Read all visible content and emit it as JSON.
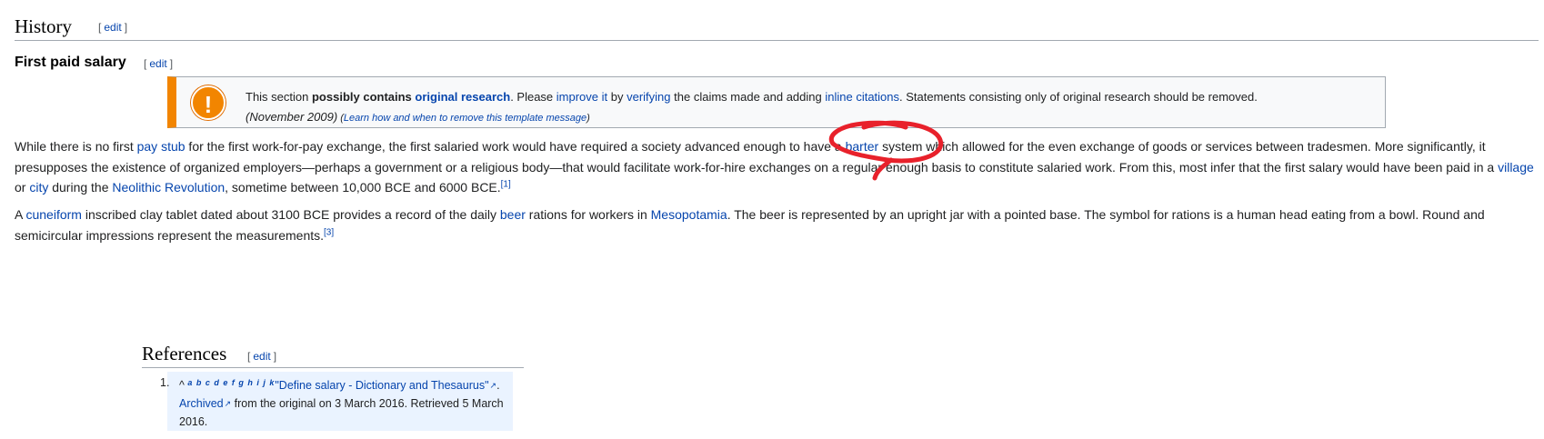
{
  "history": {
    "title": "History",
    "edit": "edit"
  },
  "first_paid_salary": {
    "title": "First paid salary",
    "edit": "edit"
  },
  "ambox": {
    "icon": "exclamation-icon",
    "l1_a": "This section ",
    "l1_b": "possibly contains ",
    "l1_c": "original research",
    "l1_d": ". Please ",
    "l1_e": "improve it",
    "l1_f": " by ",
    "l1_g": "verifying",
    "l1_h": " the claims made and adding ",
    "l1_i": "inline citations",
    "l1_j": ". Statements consisting only of original research should be removed.",
    "date": "(November 2009)",
    "learn_open": " (",
    "learn": "Learn how and when to remove this template message",
    "learn_close": ")"
  },
  "para1": {
    "l1_a": "While there is no first ",
    "l1_b": "pay stub",
    "l1_c": " for the first work-for-pay exchange, the first salaried work would have required a society advanced enough to have a ",
    "l1_d": "barter",
    "l1_e": " system which allowed for the even exchange of goods or services between tradesmen. More significantly, it",
    "l2_a": "presupposes the existence of organized employers—perhaps a government or a religious body—that would facilitate work-for-hire exchanges on a regular enough basis to constitute salaried work. From this, most infer that the first salary would have been paid in a ",
    "l2_b": "village",
    "l3_a": "or ",
    "l3_b": "city",
    "l3_c": " during the ",
    "l3_d": "Neolithic Revolution",
    "l3_e": ", sometime between 10,000 BCE and 6000 BCE.",
    "l3_sup": "[1]"
  },
  "para2": {
    "l1_a": "A ",
    "l1_b": "cuneiform",
    "l1_c": " inscribed clay tablet dated about 3100 BCE provides a record of the daily ",
    "l1_d": "beer",
    "l1_e": " rations for workers in ",
    "l1_f": "Mesopotamia",
    "l1_g": ". The beer is represented by an upright jar with a pointed base. The symbol for rations is a human head eating from a bowl. Round and",
    "l2_a": "semicircular impressions represent the measurements.",
    "l2_sup": "[3]"
  },
  "references": {
    "title": "References",
    "edit": "edit",
    "items": [
      {
        "num": "1.",
        "caret": "^",
        "letters": "a b c d e f g h i j k",
        "title": "\"Define salary - Dictionary and Thesaurus\"",
        "title_after": ".",
        "archived": "Archived",
        "l2_rest": " from the original on 3 March 2016. Retrieved 5 March",
        "l3": "2016."
      }
    ]
  },
  "colors": {
    "link": "#0645ad",
    "ambox_border": "#f28500",
    "annotation": "#e8212b",
    "ref_highlight": "#eaf3ff"
  }
}
